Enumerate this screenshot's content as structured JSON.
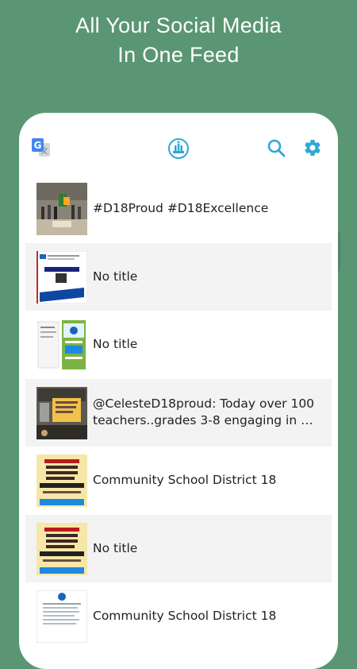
{
  "promo": {
    "line1": "All Your Social Media",
    "line2": "In One Feed"
  },
  "appbar": {
    "left_icon": "google-translate-icon",
    "center_icon": "district-logo-icon",
    "search_icon": "search-icon",
    "settings_icon": "gear-icon",
    "accent_color": "#2ea9d6"
  },
  "feed": {
    "items": [
      {
        "text": "#D18Proud #D18Excellence"
      },
      {
        "text": "No title"
      },
      {
        "text": "No title"
      },
      {
        "text_line1": "@CelesteD18proud: Today over 100",
        "text_line2": "teachers..grades 3-8 engaging in …"
      },
      {
        "text": "Community School District 18"
      },
      {
        "text": "No title"
      },
      {
        "text": "Community School District 18"
      }
    ]
  },
  "colors": {
    "background": "#5a9673",
    "card": "#ffffff",
    "alt_row": "#f3f3f3"
  }
}
